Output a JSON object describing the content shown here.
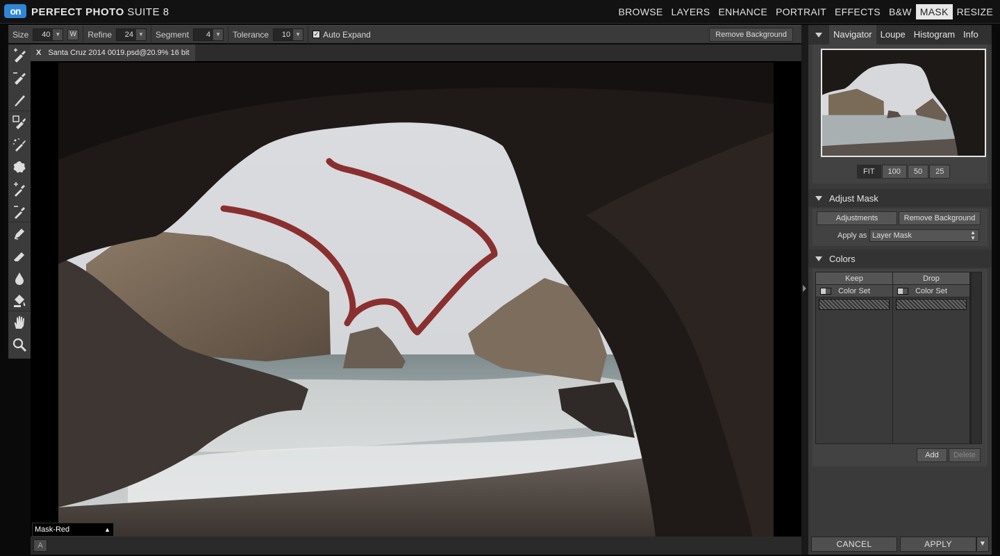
{
  "app": {
    "logo_text": "on",
    "title_bold": "PERFECT PHOTO",
    "title_light": "SUITE 8"
  },
  "modules": [
    "BROWSE",
    "LAYERS",
    "ENHANCE",
    "PORTRAIT",
    "EFFECTS",
    "B&W",
    "MASK",
    "RESIZE"
  ],
  "active_module": "MASK",
  "options": {
    "size_label": "Size",
    "size_value": "40",
    "w_label": "W",
    "refine_label": "Refine",
    "refine_value": "24",
    "segment_label": "Segment",
    "segment_value": "4",
    "tolerance_label": "Tolerance",
    "tolerance_value": "10",
    "auto_expand_label": "Auto Expand",
    "auto_expand_checked": true,
    "remove_background_label": "Remove Background"
  },
  "document": {
    "close_label": "X",
    "tab_title": "Santa Cruz 2014 0019.psd@20.9% 16 bit"
  },
  "canvas": {
    "mask_mode": "Mask-Red",
    "a_button": "A"
  },
  "tools": [
    "keep-brush",
    "drop-brush",
    "fine-brush",
    "keep-drop-brush",
    "magic-brush",
    "blob-brush",
    "keep-eyedropper",
    "drop-eyedropper",
    "pen",
    "eraser",
    "blur-drop",
    "paint-bucket",
    "hand",
    "zoom"
  ],
  "navigator": {
    "tabs": [
      "Navigator",
      "Loupe",
      "Histogram",
      "Info"
    ],
    "active_tab": "Navigator",
    "zoom_levels": [
      "FIT",
      "100",
      "50",
      "25"
    ],
    "active_zoom": "FIT"
  },
  "adjust_mask": {
    "title": "Adjust Mask",
    "adjustments_label": "Adjustments",
    "remove_background_label": "Remove Background",
    "apply_as_label": "Apply as",
    "apply_as_value": "Layer Mask"
  },
  "colors": {
    "title": "Colors",
    "keep_header": "Keep",
    "drop_header": "Drop",
    "keep_row": "Color Set",
    "drop_row": "Color Set",
    "add_label": "Add",
    "delete_label": "Delete"
  },
  "footer": {
    "cancel_label": "CANCEL",
    "apply_label": "APPLY",
    "apply_menu_icon": "▼"
  },
  "colors_ui": {
    "brush_stroke": "#8a2f2f",
    "sky": "#d8d9dc",
    "rock": "#2a2522",
    "active_module_bg": "#e8e8e8"
  }
}
